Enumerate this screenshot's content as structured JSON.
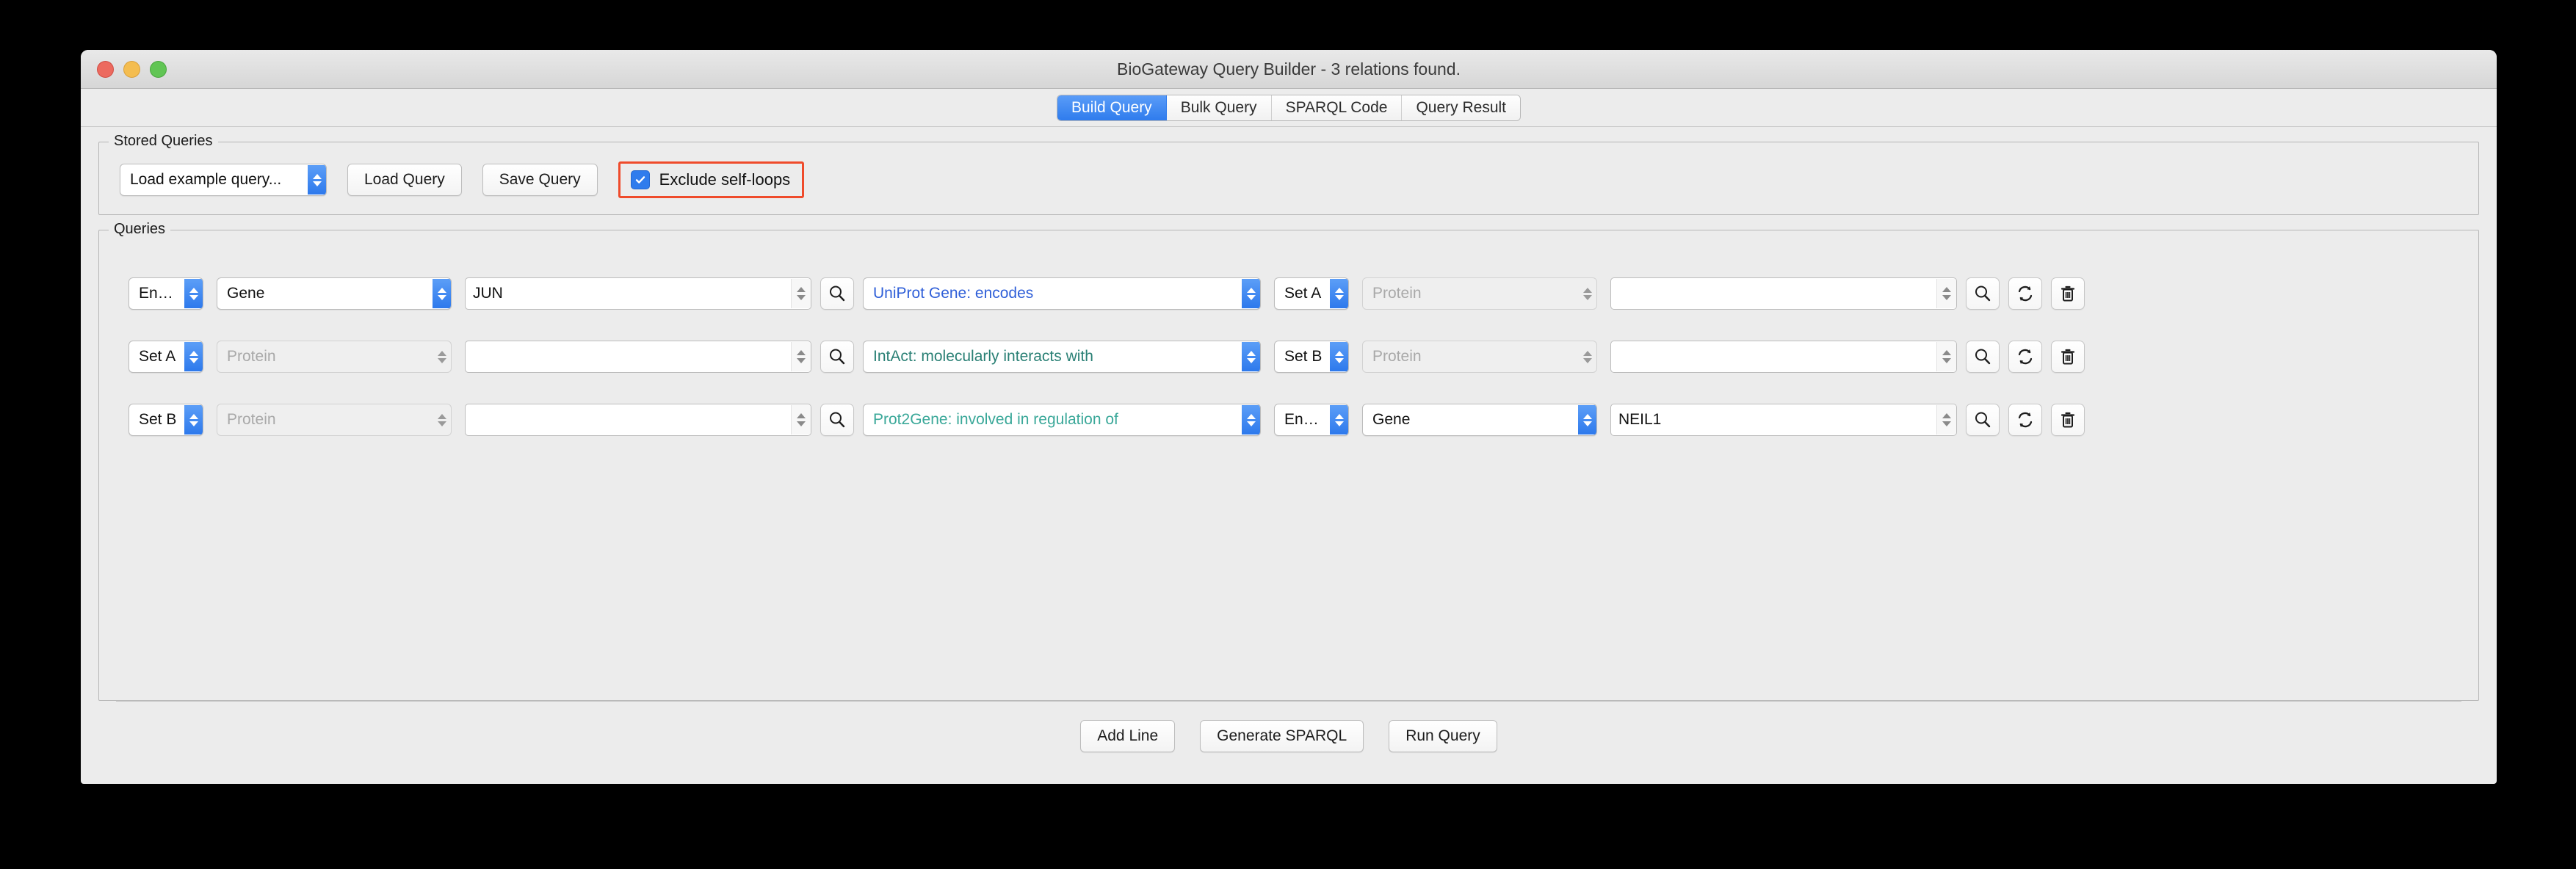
{
  "window": {
    "title": "BioGateway Query Builder - 3 relations found.",
    "traffic_lights": [
      "close-red",
      "minimize-yellow",
      "zoom-green"
    ]
  },
  "tabs": [
    {
      "label": "Build Query",
      "active": true
    },
    {
      "label": "Bulk Query",
      "active": false
    },
    {
      "label": "SPARQL Code",
      "active": false
    },
    {
      "label": "Query Result",
      "active": false
    }
  ],
  "stored_queries": {
    "group_label": "Stored Queries",
    "example_select": "Load example query...",
    "load_button": "Load Query",
    "save_button": "Save Query",
    "exclude_self_loops": {
      "label": "Exclude self-loops",
      "checked": true,
      "highlight_color": "#ef4b2b"
    }
  },
  "queries": {
    "group_label": "Queries",
    "rows": [
      {
        "subject_type": "Entity:",
        "subject_class": "Gene",
        "subject_class_disabled": false,
        "subject_value": "JUN",
        "subject_value_editable": true,
        "relation": "UniProt Gene: encodes",
        "relation_color": "#2f5fd8",
        "object_type": "Set A",
        "object_class": "Protein",
        "object_class_disabled": true,
        "object_value": "",
        "object_value_editable": true
      },
      {
        "subject_type": "Set A",
        "subject_class": "Protein",
        "subject_class_disabled": true,
        "subject_value": "",
        "subject_value_editable": true,
        "relation": "IntAct: molecularly interacts with",
        "relation_color": "#2a8075",
        "object_type": "Set B",
        "object_class": "Protein",
        "object_class_disabled": true,
        "object_value": "",
        "object_value_editable": true
      },
      {
        "subject_type": "Set B",
        "subject_class": "Protein",
        "subject_class_disabled": true,
        "subject_value": "",
        "subject_value_editable": true,
        "relation": "Prot2Gene: involved in regulation of",
        "relation_color": "#3aa899",
        "object_type": "Entity:",
        "object_class": "Gene",
        "object_class_disabled": false,
        "object_value": "NEIL1",
        "object_value_editable": true
      }
    ],
    "row_icons": [
      "search-icon",
      "swap-icon",
      "trash-icon"
    ]
  },
  "footer": {
    "add_line": "Add Line",
    "generate_sparql": "Generate SPARQL",
    "run_query": "Run Query"
  },
  "colors": {
    "accent_blue": "#2f7ced",
    "highlight_red": "#ef4b2b",
    "window_bg": "#ececec"
  }
}
